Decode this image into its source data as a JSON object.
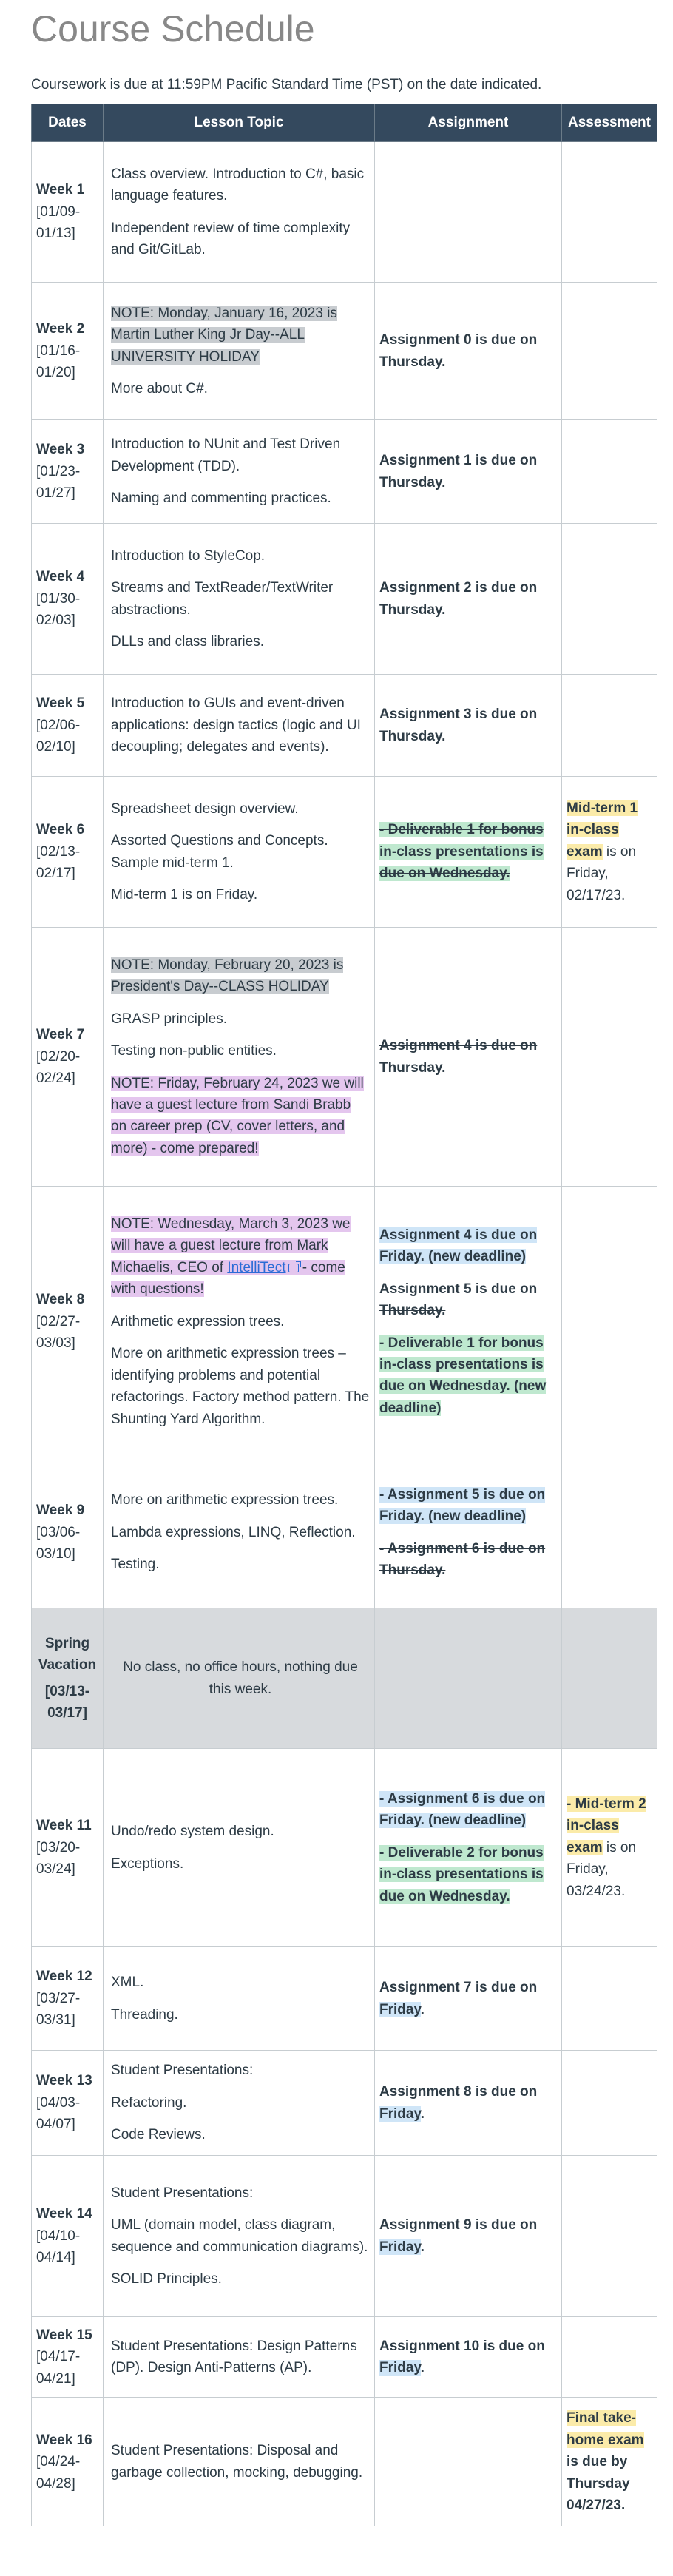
{
  "page_title": "Course Schedule",
  "intro": "Coursework is due at 11:59PM Pacific Standard Time (PST) on the date indicated.",
  "headers": {
    "dates": "Dates",
    "topic": "Lesson Topic",
    "assignment": "Assignment",
    "assessment": "Assessment"
  },
  "rows": [
    {
      "week": "Week 1",
      "range": "[01/09-01/13]",
      "topic": [
        "Class overview. Introduction to C#, basic language features.",
        "Independent review of time complexity and Git/GitLab."
      ]
    },
    {
      "week": "Week 2",
      "range": "[01/16-01/20]",
      "topic": [
        "NOTE: Monday, January 16, 2023 is Martin Luther King Jr Day--ALL UNIVERSITY HOLIDAY",
        "More about C#."
      ],
      "assign": [
        "Assignment 0 is due on Thursday."
      ]
    },
    {
      "week": "Week 3",
      "range": "[01/23-01/27]",
      "topic": [
        "Introduction to NUnit and Test Driven Development (TDD).",
        "Naming and commenting practices."
      ],
      "assign": [
        "Assignment 1 is due on Thursday."
      ]
    },
    {
      "week": "Week 4",
      "range": "[01/30-02/03]",
      "topic": [
        "Introduction to StyleCop.",
        "Streams and TextReader/TextWriter abstractions.",
        "DLLs and class libraries."
      ],
      "assign": [
        "Assignment 2 is due on Thursday."
      ]
    },
    {
      "week": "Week 5",
      "range": "[02/06-02/10]",
      "topic": [
        "Introduction to GUIs and event-driven applications: design tactics (logic and UI decoupling; delegates and events)."
      ],
      "assign": [
        "Assignment 3 is due on Thursday."
      ]
    },
    {
      "week": "Week 6",
      "range": "[02/13-02/17]",
      "topic": [
        "Spreadsheet design overview.",
        "Assorted Questions and Concepts. Sample mid-term 1.",
        "Mid-term 1 is on Friday."
      ],
      "assign": [
        "- Deliverable 1 for bonus in-class presentations is due on Wednesday."
      ],
      "assess_hl": "Mid-term 1 in-class exam",
      "assess_rest": " is on Friday, 02/17/23."
    },
    {
      "week": "Week 7",
      "range": "[02/20-02/24]",
      "topic": [
        "NOTE: Monday, February 20, 2023 is President's Day--CLASS HOLIDAY",
        "GRASP principles.",
        "Testing non-public entities.",
        "NOTE: Friday, February 24, 2023 we will have a guest lecture from Sandi Brabb on career prep (CV, cover letters, and more) - come prepared!"
      ],
      "assign": [
        "Assignment 4 is due on Thursday."
      ]
    },
    {
      "week": "Week 8",
      "range": "[02/27-03/03]",
      "note_before": "NOTE: Wednesday, March 3, 2023 we will have a guest lecture from Mark Michaelis, CEO of ",
      "note_link": "IntelliTect",
      "note_after": " - come with questions!",
      "topic": [
        "Arithmetic expression trees.",
        "More on arithmetic expression trees – identifying problems and potential refactorings. Factory method pattern. The Shunting Yard Algorithm."
      ],
      "assign": [
        "Assignment 4 is due on Friday. (new deadline)",
        "Assignment 5 is due on Thursday.",
        "- Deliverable 1 for bonus in-class presentations is due on Wednesday.  (new deadline)"
      ]
    },
    {
      "week": "Week 9",
      "range": "[03/06-03/10]",
      "topic": [
        "More on arithmetic expression trees.",
        "Lambda expressions, LINQ, Reflection.",
        "Testing."
      ],
      "assign": [
        "- Assignment 5 is due on Friday. (new deadline)",
        "- Assignment 6 is due on Thursday."
      ]
    },
    {
      "week": "Spring Vacation",
      "range": "[03/13-03/17]",
      "topic": [
        "No class, no office hours, nothing due this week."
      ]
    },
    {
      "week": "Week 11",
      "range": "[03/20-03/24]",
      "topic": [
        "Undo/redo system design.",
        "Exceptions."
      ],
      "assign": [
        "- Assignment 6 is due on Friday. (new deadline)",
        "- Deliverable 2 for bonus in-class presentations is due on Wednesday."
      ],
      "assess_hl": "- Mid-term 2 in-class exam",
      "assess_rest": " is on Friday, 03/24/23."
    },
    {
      "week": "Week 12",
      "range": "[03/27-03/31]",
      "topic": [
        "XML.",
        "Threading."
      ],
      "assign_pre": "Assignment 7 is due on ",
      "assign_day": "Friday",
      "assign_post": "."
    },
    {
      "week": "Week 13",
      "range": "[04/03-04/07]",
      "topic": [
        "Student Presentations:",
        "Refactoring.",
        "Code Reviews."
      ],
      "assign_pre": "Assignment 8 is due on ",
      "assign_day": "Friday",
      "assign_post": "."
    },
    {
      "week": "Week 14",
      "range": "[04/10-04/14]",
      "topic": [
        "Student Presentations:",
        "UML (domain model, class diagram, sequence and communication diagrams).",
        "SOLID Principles."
      ],
      "assign_pre": "Assignment 9 is due on ",
      "assign_day": "Friday",
      "assign_post": "."
    },
    {
      "week": "Week 15",
      "range": "[04/17-04/21]",
      "topic": [
        "Student Presentations: Design Patterns (DP). Design Anti-Patterns (AP)."
      ],
      "assign_pre": "Assignment 10 is due on ",
      "assign_day": "Friday",
      "assign_post": "."
    },
    {
      "week": "Week 16",
      "range": "[04/24-04/28]",
      "topic": [
        "Student Presentations: Disposal and garbage collection, mocking, debugging."
      ],
      "assess_hl": "Final take-home exam",
      "assess_rest": " is due by Thursday 04/27/23."
    }
  ],
  "colors": {
    "header_bg": "#34495e",
    "highlight_gray": "#c8ccd0",
    "highlight_purple": "#e4c6ee",
    "highlight_green": "#bfe8cf",
    "highlight_blue": "#cfe5f7",
    "highlight_yellow": "#fbeba9",
    "link": "#2b6cd6"
  },
  "icons": {
    "external_link": "external-link-icon"
  }
}
